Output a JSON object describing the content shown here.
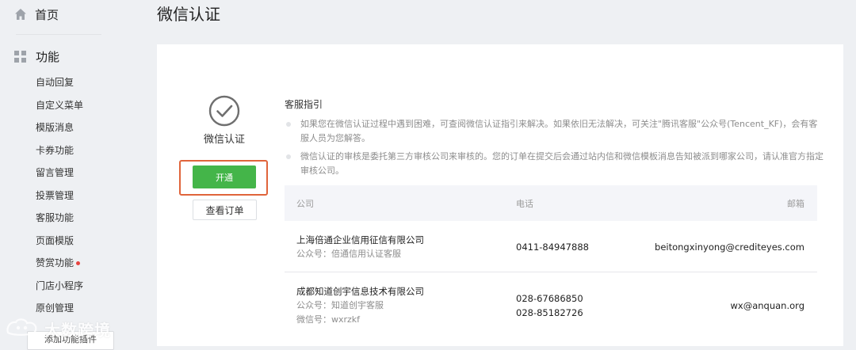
{
  "sidebar": {
    "home_label": "首页",
    "function_label": "功能",
    "items": [
      {
        "label": "自动回复"
      },
      {
        "label": "自定义菜单"
      },
      {
        "label": "模版消息"
      },
      {
        "label": "卡券功能"
      },
      {
        "label": "留言管理"
      },
      {
        "label": "投票管理"
      },
      {
        "label": "客服功能"
      },
      {
        "label": "页面模版"
      },
      {
        "label": "赞赏功能",
        "dot": true
      },
      {
        "label": "门店小程序"
      },
      {
        "label": "原创管理"
      }
    ],
    "bottom_button": "添加功能插件"
  },
  "watermark": "大数跨境",
  "page_title": "微信认证",
  "status": {
    "label": "微信认证",
    "open_button": "开通",
    "orders_button": "查看订单"
  },
  "guide": {
    "title": "客服指引",
    "items": [
      "如果您在微信认证过程中遇到困难，可查阅微信认证指引来解决。如果依旧无法解决，可关注\"腾讯客服\"公众号(Tencent_KF)，会有客服人员为您解答。",
      "微信认证的审核是委托第三方审核公司来审核的。您的订单在提交后会通过站内信和微信模板消息告知被派到哪家公司，请认准官方指定审核公司。"
    ]
  },
  "table": {
    "headers": {
      "company": "公司",
      "phone": "电话",
      "email": "邮箱"
    },
    "rows": [
      {
        "company": "上海倍通企业信用征信有限公司",
        "sub": [
          "公众号：倍通信用认证客服"
        ],
        "phones": [
          "0411-84947888"
        ],
        "email": "beitongxinyong@crediteyes.com"
      },
      {
        "company": "成都知道创宇信息技术有限公司",
        "sub": [
          "公众号：知道创宇客服",
          "微信号：wxrzkf"
        ],
        "phones": [
          "028-67686850",
          "028-85182726"
        ],
        "email": "wx@anquan.org"
      }
    ]
  },
  "colors": {
    "accent_green": "#44b549",
    "highlight_orange": "#e0643b",
    "badge_red": "#e64340"
  }
}
